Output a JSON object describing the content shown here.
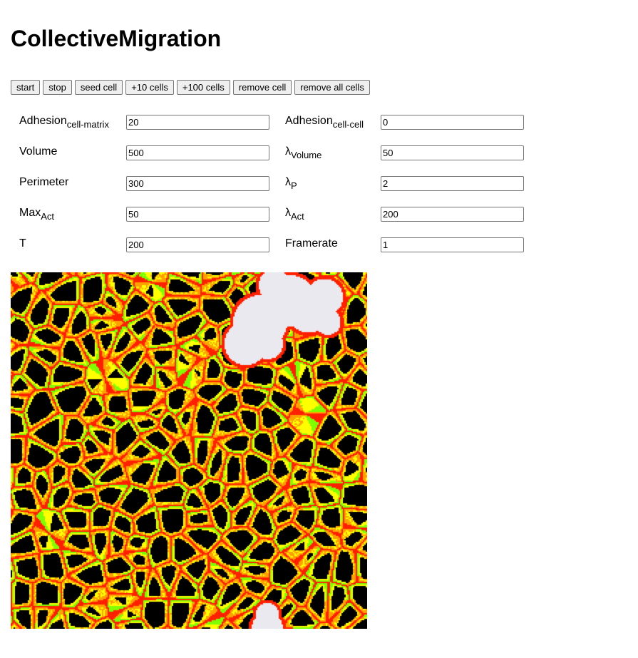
{
  "page": {
    "title": "CollectiveMigration"
  },
  "toolbar": {
    "start": "start",
    "stop": "stop",
    "seed_cell": "seed cell",
    "add10": "+10 cells",
    "add100": "+100 cells",
    "remove_cell": "remove cell",
    "remove_all": "remove all cells"
  },
  "params": {
    "adhesion_cm": {
      "base": "Adhesion",
      "sub": "cell-matrix",
      "value": "20"
    },
    "adhesion_cc": {
      "base": "Adhesion",
      "sub": "cell-cell",
      "value": "0"
    },
    "volume": {
      "base": "Volume",
      "value": "500"
    },
    "lambda_volume": {
      "base": "λ",
      "sub": "Volume",
      "value": "50"
    },
    "perimeter": {
      "base": "Perimeter",
      "value": "300"
    },
    "lambda_p": {
      "base": "λ",
      "sub": "P",
      "value": "2"
    },
    "max_act": {
      "base": "Max",
      "sub": "Act",
      "value": "50"
    },
    "lambda_act": {
      "base": "λ",
      "sub": "Act",
      "value": "200"
    },
    "temperature": {
      "base": "T",
      "value": "200"
    },
    "framerate": {
      "base": "Framerate",
      "value": "1"
    }
  },
  "simulation": {
    "colors": {
      "background": "#000000",
      "empty": "#e9e9ef",
      "cell_border": "#ff2000",
      "act_high": "#ffff00",
      "act_mid": "#ffa000",
      "act_front": "#7fff00"
    }
  }
}
